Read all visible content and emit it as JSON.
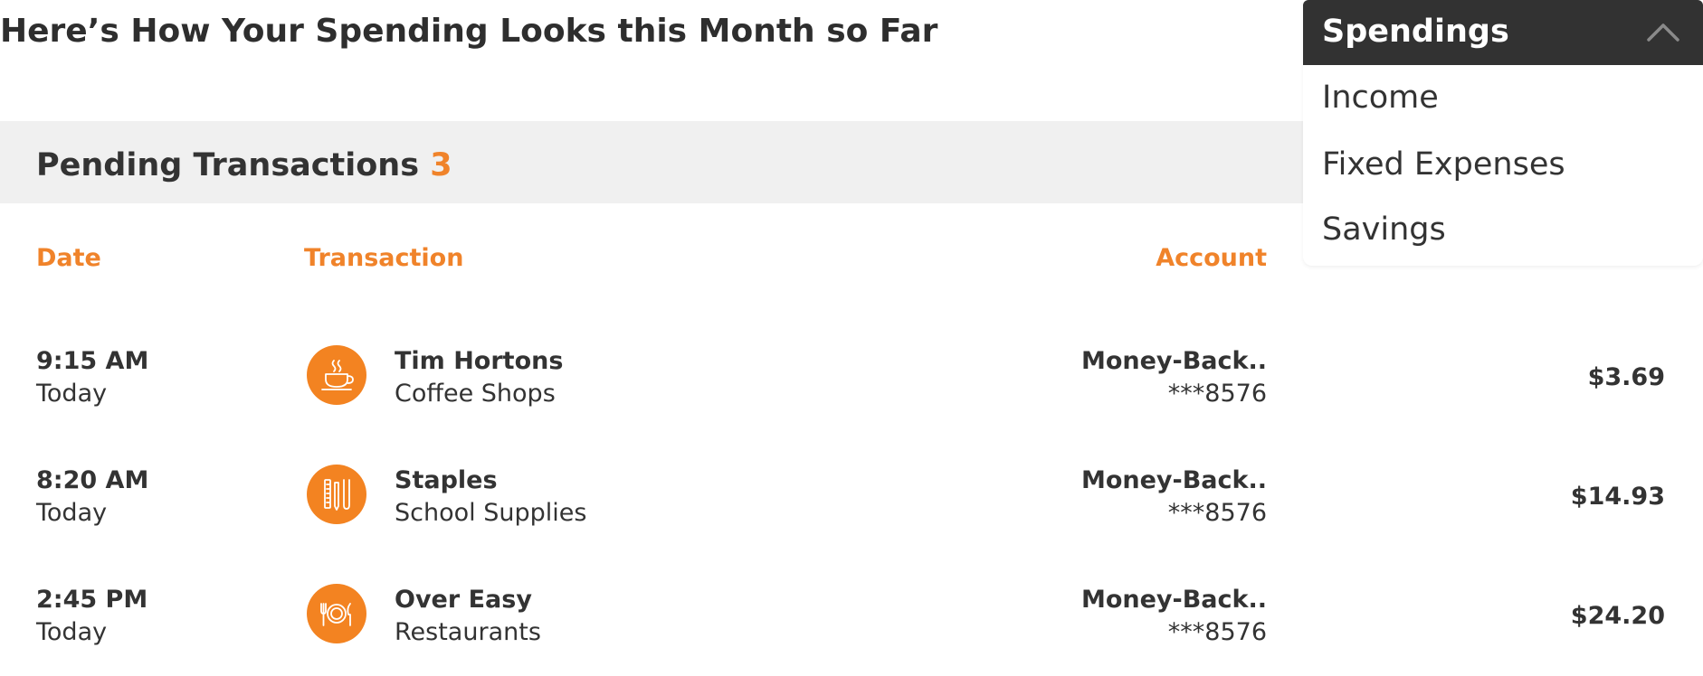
{
  "page": {
    "title": "Here’s How Your Spending Looks this Month so Far"
  },
  "pending": {
    "label": "Pending Transactions",
    "count": "3"
  },
  "table": {
    "headers": {
      "date": "Date",
      "transaction": "Transaction",
      "account": "Account"
    },
    "rows": [
      {
        "time": "9:15 AM",
        "day": "Today",
        "icon": "coffee-cup-icon",
        "merchant": "Tim Hortons",
        "category": "Coffee Shops",
        "account_name": "Money-Back..",
        "account_number": "***8576",
        "amount": "$3.69"
      },
      {
        "time": "8:20 AM",
        "day": "Today",
        "icon": "school-supplies-icon",
        "merchant": "Staples",
        "category": "School Supplies",
        "account_name": "Money-Back..",
        "account_number": "***8576",
        "amount": "$14.93"
      },
      {
        "time": "2:45 PM",
        "day": "Today",
        "icon": "plate-cutlery-icon",
        "merchant": "Over Easy",
        "category": "Restaurants",
        "account_name": "Money-Back..",
        "account_number": "***8576",
        "amount": "$24.20"
      }
    ]
  },
  "dropdown": {
    "selected": "Spendings",
    "options": [
      "Income",
      "Fixed Expenses",
      "Savings"
    ]
  },
  "colors": {
    "accent": "#f0832a",
    "icon_bg": "#f38321",
    "dropdown_header": "#323232",
    "band": "#f0f0f0",
    "text": "#333333"
  }
}
